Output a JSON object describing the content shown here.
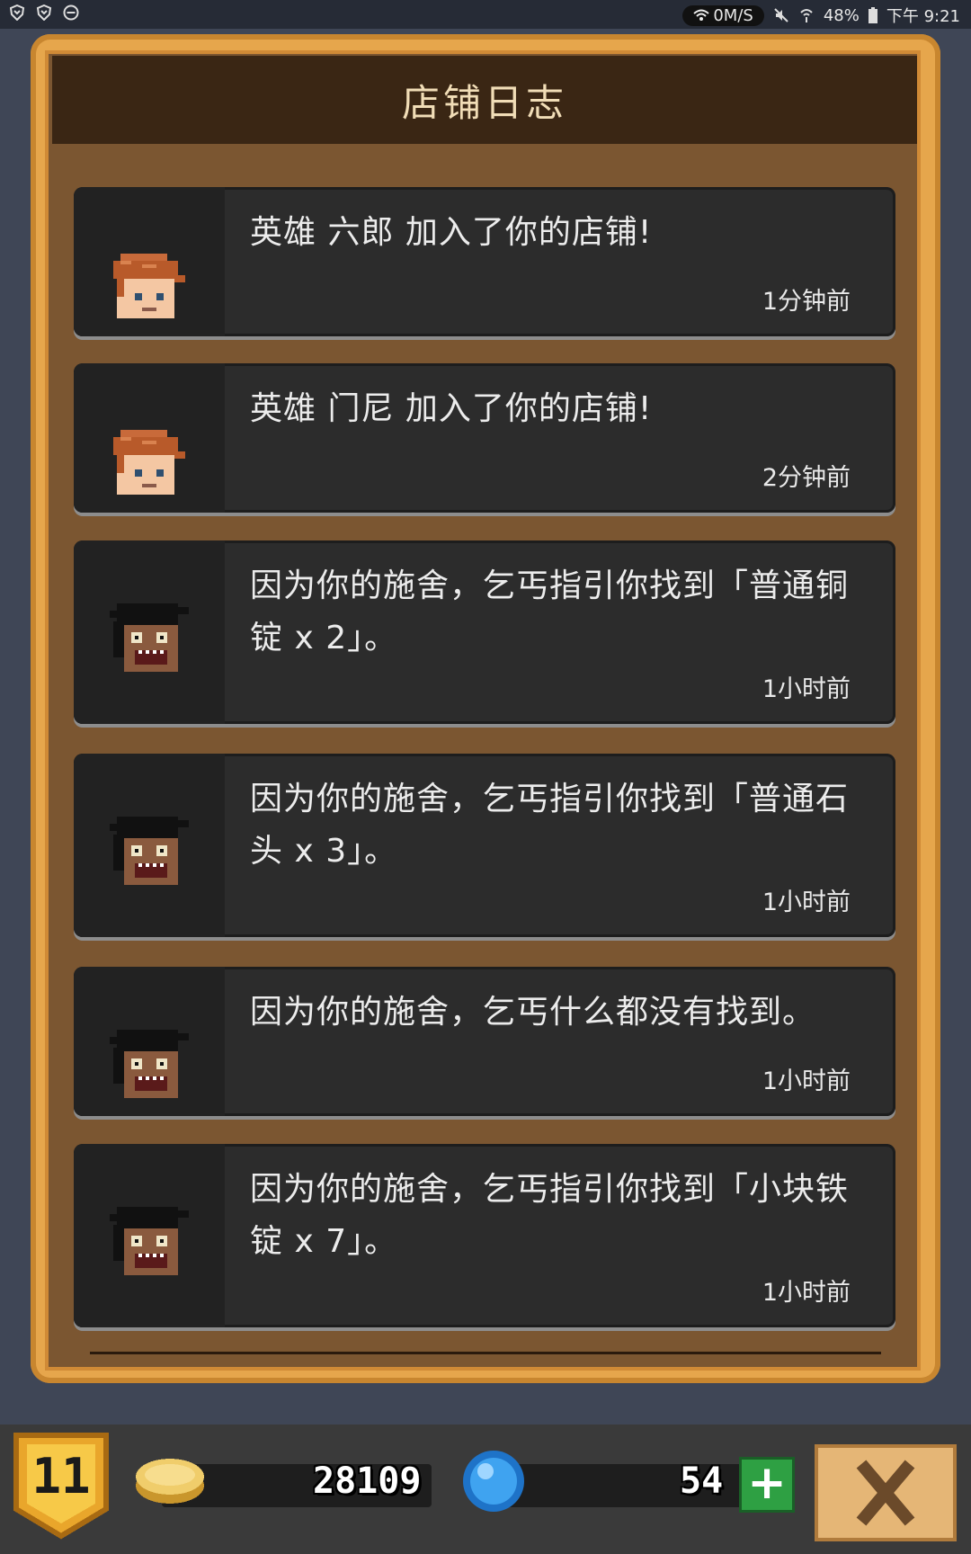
{
  "status_bar": {
    "net_speed": "0M/S",
    "battery": "48%",
    "time": "下午 9:21"
  },
  "dialog": {
    "title": "店铺日志"
  },
  "log_entries": [
    {
      "message": "英雄 六郎 加入了你的店铺!",
      "time": "1分钟前",
      "avatar": "hero-redhair-icon"
    },
    {
      "message": "英雄 门尼 加入了你的店铺!",
      "time": "2分钟前",
      "avatar": "hero-redhair-icon"
    },
    {
      "message": "因为你的施舍，乞丐指引你找到「普通铜锭 x 2」。",
      "time": "1小时前",
      "avatar": "beggar-icon"
    },
    {
      "message": "因为你的施舍，乞丐指引你找到「普通石头 x 3」。",
      "time": "1小时前",
      "avatar": "beggar-icon"
    },
    {
      "message": "因为你的施舍，乞丐什么都没有找到。",
      "time": "1小时前",
      "avatar": "beggar-icon"
    },
    {
      "message": "因为你的施舍，乞丐指引你找到「小块铁锭 x 7」。",
      "time": "1小时前",
      "avatar": "beggar-icon"
    }
  ],
  "bottom_bar": {
    "level": "11",
    "gold": "28109",
    "gems": "54",
    "plus_label": "+"
  }
}
